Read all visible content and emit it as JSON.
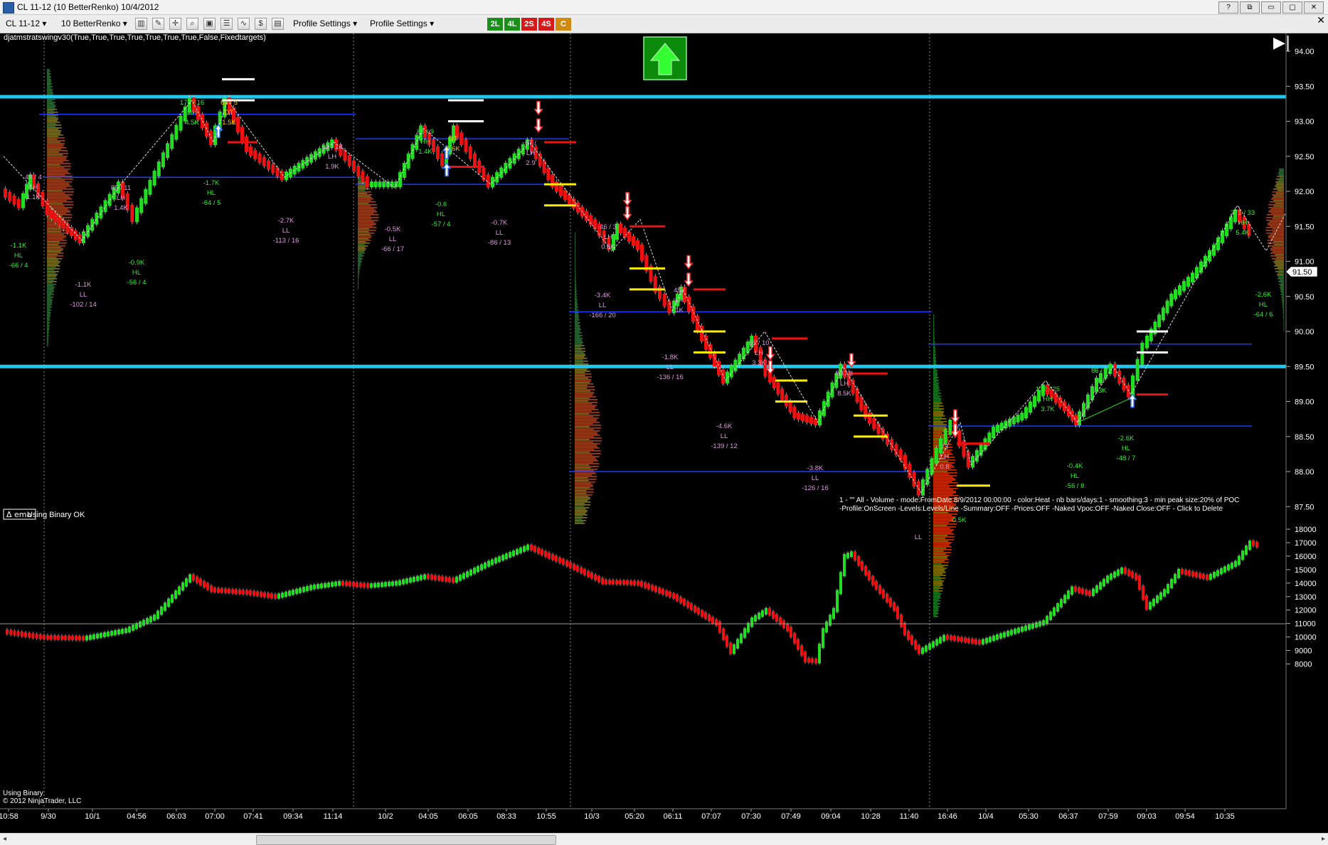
{
  "window": {
    "title": "CL 11-12 (10 BetterRenko)  10/4/2012",
    "buttons": [
      "?",
      "⧉",
      "▭",
      "▢",
      "✕"
    ],
    "close": "✕"
  },
  "toolbar": {
    "instrument": "CL 11-12",
    "bartype": "10 BetterRenko",
    "profile1": "Profile Settings",
    "profile2": "Profile Settings",
    "signals": [
      {
        "label": "2L",
        "color": "#1a8f1a"
      },
      {
        "label": "4L",
        "color": "#1a8f1a"
      },
      {
        "label": "2S",
        "color": "#d61a1a"
      },
      {
        "label": "4S",
        "color": "#d61a1a"
      },
      {
        "label": "C",
        "color": "#d08a10"
      }
    ]
  },
  "colors": {
    "up": "#22dd22",
    "down": "#ee1111",
    "cyan_line": "#20c8f0",
    "blue_line": "#1a3cff",
    "yellow": "#ffee00",
    "white": "#ffffff",
    "green_text": "#33ee33",
    "pink_text": "#dd99dd",
    "gold_text": "#ffcc00",
    "red_label": "#ff4444"
  },
  "indicator_label": "djatmstratswingv30(True,True,True,True,True,True,True,False,Fixedtargets)",
  "ema_label": "Δ ema",
  "binary_ok": "Using Binary OK",
  "using_binary": "Using Binary",
  "copyright": "© 2012 NinjaTrader, LLC",
  "current_price": "91.50",
  "nav_icon": "▶|",
  "profile_info": [
    "1 - \"\" All - Volume - mode:FromDate 8/9/2012 00:00:00  - color:Heat - nb bars/days:1 - smoothing:3 - min peak size:20% of POC",
    "-Profile:OnScreen -Levels:Levels/Line -Summary:OFF -Prices:OFF -Naked Vpoc:OFF -Naked Close:OFF - Click to Delete"
  ],
  "price_axis": {
    "labels": [
      "94.00",
      "93.50",
      "93.00",
      "92.50",
      "92.00",
      "91.50",
      "91.00",
      "90.50",
      "90.00",
      "89.50",
      "89.00",
      "88.50",
      "88.00",
      "87.50"
    ],
    "values": [
      94.0,
      93.5,
      93.0,
      92.5,
      92.0,
      91.5,
      91.0,
      90.5,
      90.0,
      89.5,
      89.0,
      88.5,
      88.0,
      87.5
    ]
  },
  "volume_axis": {
    "labels": [
      "18000",
      "17000",
      "16000",
      "15000",
      "14000",
      "13000",
      "12000",
      "11000",
      "10000",
      "9000",
      "8000"
    ],
    "values": [
      18000,
      17000,
      16000,
      15000,
      14000,
      13000,
      12000,
      11000,
      10000,
      9000,
      8000
    ]
  },
  "time_axis": [
    "10:58",
    "9/30",
    "10/1",
    "04:56",
    "06:03",
    "07:00",
    "07:41",
    "09:34",
    "11:14",
    "10/2",
    "04:05",
    "06:05",
    "08:33",
    "10:55",
    "10/3",
    "05:20",
    "06:11",
    "07:07",
    "07:30",
    "07:49",
    "09:04",
    "10:28",
    "11:40",
    "16:46",
    "10/4",
    "05:30",
    "06:37",
    "07:59",
    "09:03",
    "09:54",
    "10:35"
  ],
  "swing_labels": [
    {
      "lines": [
        "48 / 4",
        "LH",
        "1.1K"
      ],
      "color": "#dd99dd"
    },
    {
      "lines": [
        "-1.1K",
        "HL",
        "-66 / 4"
      ],
      "color": "#33ee33"
    },
    {
      "lines": [
        "-1.1K",
        "LL",
        "-102 / 14"
      ],
      "color": "#dd99dd"
    },
    {
      "lines": [
        "85 / 11",
        "LH",
        "1.4K"
      ],
      "color": "#dd99dd"
    },
    {
      "lines": [
        "-0.9K",
        "HL",
        "-56 / 4"
      ],
      "color": "#33ee33"
    },
    {
      "lines": [
        "178 / 16",
        "HH",
        "4.5K"
      ],
      "color": "#33ee33"
    },
    {
      "lines": [
        "63 / 5",
        "DT",
        "1.5K"
      ],
      "color": "#ffcc00"
    },
    {
      "lines": [
        "-1.7K",
        "HL",
        "-64 / 5"
      ],
      "color": "#33ee33"
    },
    {
      "lines": [
        "-2.7K",
        "LL",
        "-113 / 16"
      ],
      "color": "#dd99dd"
    },
    {
      "lines": [
        "51 / 13",
        "LH",
        "1.9K"
      ],
      "color": "#dd99dd"
    },
    {
      "lines": [
        "-0.5K",
        "LL",
        "-66 / 17"
      ],
      "color": "#dd99dd"
    },
    {
      "lines": [
        "88 / 9",
        "HH",
        "1.4K"
      ],
      "color": "#33ee33"
    },
    {
      "lines": [
        "DT",
        "0.6K"
      ],
      "color": "#ffcc00"
    },
    {
      "lines": [
        "-0.6",
        "HL",
        "-57 / 4"
      ],
      "color": "#33ee33"
    },
    {
      "lines": [
        "-0.7K",
        "LL",
        "-86 / 13"
      ],
      "color": "#dd99dd"
    },
    {
      "lines": [
        "67 /",
        "LH",
        "2.9"
      ],
      "color": "#dd99dd"
    },
    {
      "lines": [
        "46 / 3",
        "LH",
        "0.6K"
      ],
      "color": "#dd99dd"
    },
    {
      "lines": [
        "-3.4K",
        "LL",
        "-166 / 20"
      ],
      "color": "#dd99dd"
    },
    {
      "lines": [
        "45 /",
        "LH",
        "1K"
      ],
      "color": "#dd99dd"
    },
    {
      "lines": [
        "-1.8K",
        "LL",
        "-136 / 16"
      ],
      "color": "#dd99dd"
    },
    {
      "lines": [
        "65 / 10",
        "LH",
        "3.3K"
      ],
      "color": "#dd99dd"
    },
    {
      "lines": [
        "-4.6K",
        "LL",
        "-139 / 12"
      ],
      "color": "#dd99dd"
    },
    {
      "lines": [
        "83 / 8",
        "LH",
        "8.5K"
      ],
      "color": "#dd99dd"
    },
    {
      "lines": [
        "-3.8K",
        "LL",
        "-126 / 16"
      ],
      "color": "#dd99dd"
    },
    {
      "lines": [
        "73",
        "LH",
        "0.8"
      ],
      "color": "#dd99dd"
    },
    {
      "lines": [
        "-0.5K"
      ],
      "color": "#33ee33"
    },
    {
      "lines": [
        "LL"
      ],
      "color": "#dd99dd"
    },
    {
      "lines": [
        "132 / 25",
        "HH",
        "3.7K"
      ],
      "color": "#33ee33"
    },
    {
      "lines": [
        "-0.4K",
        "HL",
        "-56 / 8"
      ],
      "color": "#33ee33"
    },
    {
      "lines": [
        "86 / 7",
        "HH",
        "2.3K"
      ],
      "color": "#33ee33"
    },
    {
      "lines": [
        "-2.6K",
        "HL",
        "-48 / 7"
      ],
      "color": "#33ee33"
    },
    {
      "lines": [
        "271 / 33",
        "HH",
        "5.4K"
      ],
      "color": "#33ee33"
    },
    {
      "lines": [
        "-2.6K",
        "HL",
        "-64 / 6"
      ],
      "color": "#33ee33"
    }
  ]
}
